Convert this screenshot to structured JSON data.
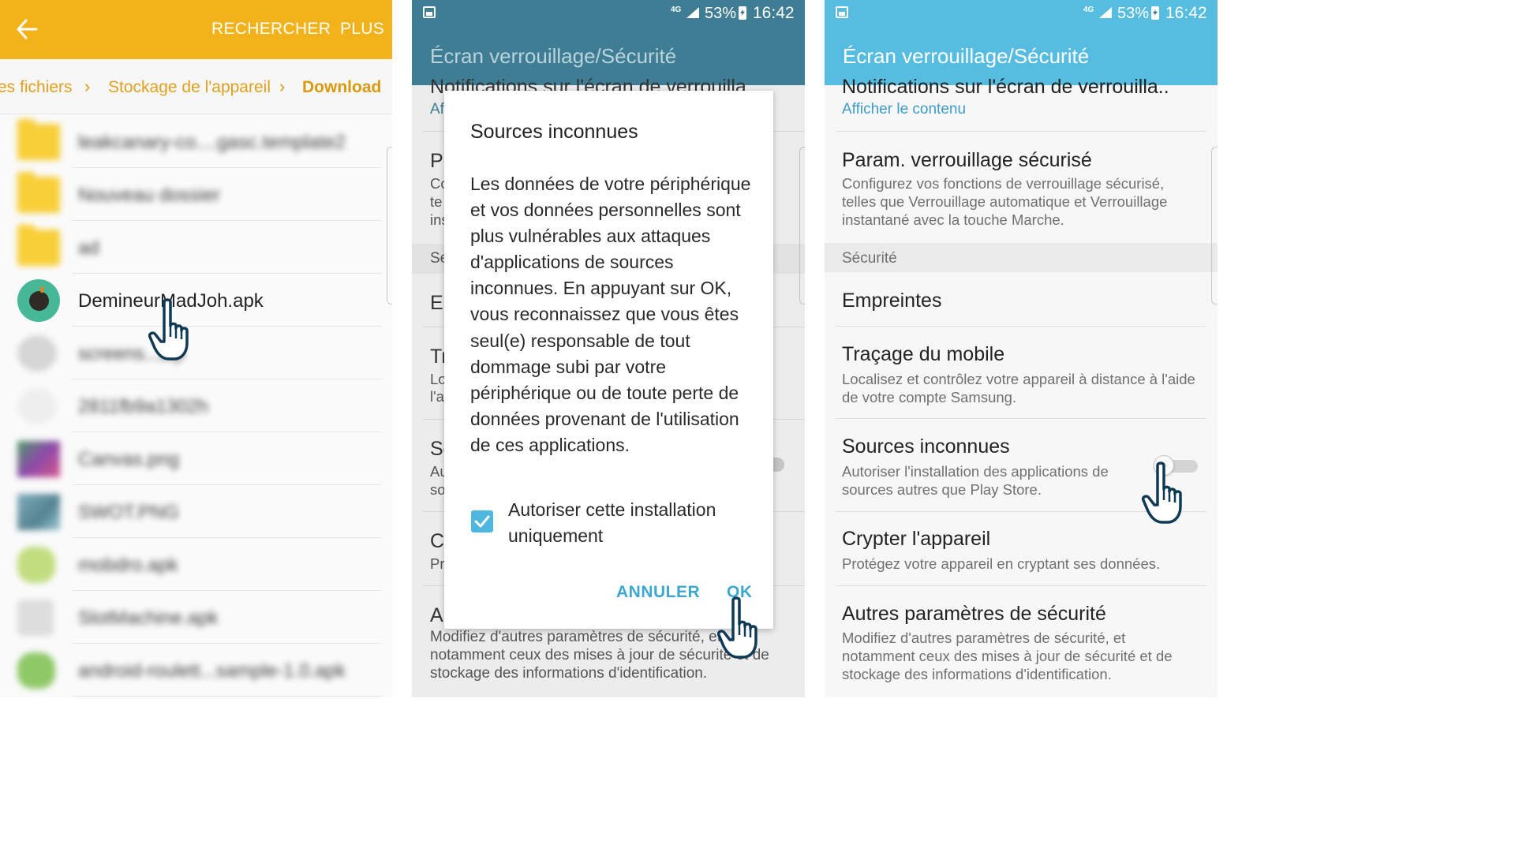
{
  "file_manager": {
    "search_label": "RECHERCHER",
    "more_label": "PLUS",
    "breadcrumb": [
      "es fichiers",
      "Stockage de l'appareil",
      "Download"
    ],
    "files": [
      {
        "name": "leakcanary-co....gasc.template2",
        "type": "folder"
      },
      {
        "name": "Nouveau dossier",
        "type": "folder"
      },
      {
        "name": "ad",
        "type": "folder"
      },
      {
        "name": "DemineurMadJoh.apk",
        "type": "apk"
      },
      {
        "name": "screens...zip",
        "type": "file"
      },
      {
        "name": "2811fb9a1302h",
        "type": "file"
      },
      {
        "name": "Canvas.png",
        "type": "image"
      },
      {
        "name": "SWOT.PNG",
        "type": "image"
      },
      {
        "name": "mobdro.apk",
        "type": "apk"
      },
      {
        "name": "SlotMachine.apk",
        "type": "apk"
      },
      {
        "name": "android-roulett...sample-1.0.apk",
        "type": "apk"
      }
    ]
  },
  "status": {
    "network": "4G",
    "battery": "53%",
    "time": "16:42"
  },
  "settings_title": "Écran verrouillage/Sécurité",
  "background_fragments": {
    "notif_title": "Notifications sur l'écran de verrouilla...",
    "notif_sub": "Af",
    "p_title": "P",
    "p_sub": [
      "Co",
      "te",
      "ins"
    ],
    "section": "Se",
    "e_title": "Er",
    "t_title": "Tr",
    "t_sub": [
      "Lo",
      "l'a"
    ],
    "s_title": "So",
    "s_sub": [
      "Au",
      "so"
    ],
    "c_title": "C",
    "c_sub": "Pr",
    "a_title": "A",
    "bottom_desc": "Modifiez d'autres paramètres de sécurité, et notamment ceux des mises à jour de sécurité et de stockage des informations d'identification."
  },
  "dialog": {
    "title": "Sources inconnues",
    "body": "Les données de votre périphérique et vos données personnelles sont plus vulnérables aux attaques d'applications de sources inconnues. En appuyant sur OK, vous reconnaissez que vous êtes seul(e) responsable de tout dommage subi par votre périphérique ou de toute perte de données provenant de l'utilisation de ces applications.",
    "checkbox_label": "Autoriser cette installation uniquement",
    "checkbox_checked": true,
    "cancel_label": "ANNULER",
    "ok_label": "OK"
  },
  "settings": {
    "notif_title": "Notifications sur l'écran de verrouilla..",
    "notif_sub": "Afficher le contenu",
    "secure_lock_title": "Param. verrouillage sécurisé",
    "secure_lock_sub": "Configurez vos fonctions de verrouillage sécurisé, telles que Verrouillage automatique et Verrouillage instantané avec la touche Marche.",
    "section_security": "Sécurité",
    "fingerprints_title": "Empreintes",
    "tracking_title": "Traçage du mobile",
    "tracking_sub": "Localisez et contrôlez votre appareil à distance à l'aide de votre compte Samsung.",
    "unknown_title": "Sources inconnues",
    "unknown_sub": "Autoriser l'installation des applications de sources autres que Play Store.",
    "unknown_enabled": false,
    "encrypt_title": "Crypter l'appareil",
    "encrypt_sub": "Protégez votre appareil en cryptant ses données.",
    "other_title": "Autres paramètres de sécurité",
    "other_sub": "Modifiez d'autres paramètres de sécurité, et notamment ceux des mises à jour de sécurité et de stockage des informations d'identification."
  },
  "colors": {
    "file_manager_header": "#f2b31a",
    "dim_appbar": "#3e7d93",
    "settings_appbar": "#56bde0",
    "accent": "#3ea7d0"
  }
}
